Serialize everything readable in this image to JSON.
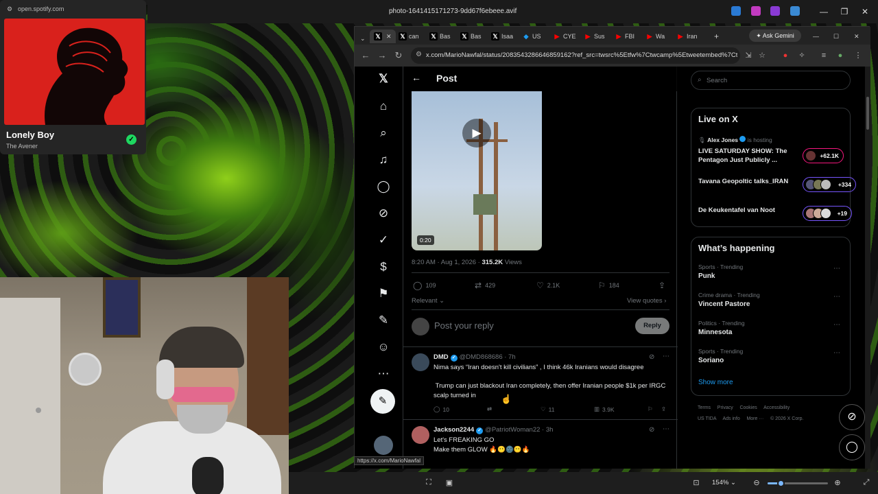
{
  "viewer": {
    "filename": "photo-1641415171273-9dd67f6ebeee.avif",
    "zoom": "154%",
    "zoom_level": 0.22
  },
  "spotify": {
    "url": "open.spotify.com",
    "song": "Lonely Boy",
    "artist": "The Avener"
  },
  "browser": {
    "tabs": [
      {
        "label": "",
        "fav": "X",
        "active": true
      },
      {
        "label": "can",
        "fav": "X"
      },
      {
        "label": "Bas",
        "fav": "X"
      },
      {
        "label": "Bas",
        "fav": "X"
      },
      {
        "label": "Isaa",
        "fav": "X"
      },
      {
        "label": "US",
        "fav": "◆"
      },
      {
        "label": "CYE",
        "fav": "▶"
      },
      {
        "label": "Sus",
        "fav": "▶"
      },
      {
        "label": "FBI",
        "fav": "▶"
      },
      {
        "label": "Wa",
        "fav": "▶"
      },
      {
        "label": "Iran",
        "fav": "▶"
      }
    ],
    "ask_gemini": "Ask Gemini",
    "url": "x.com/MarioNawfal/status/2083543286646859162?ref_src=twsrc%5Etfw%7Ctwcamp%5Etweetembed%7Ctw...",
    "status_url": "https://x.com/MarioNawfal"
  },
  "post": {
    "header_title": "Post",
    "video_duration": "0:20",
    "time": "8:20 AM · Aug 1, 2026 · ",
    "views_count": "315.2K",
    "views_label": " Views",
    "replies": "109",
    "reposts": "429",
    "likes": "2.1K",
    "bookmarks": "184",
    "relevant": "Relevant",
    "view_quotes": "View quotes",
    "reply_placeholder": "Post your reply",
    "reply_button": "Reply"
  },
  "replies": [
    {
      "name": "DMD",
      "handle": "@DMD868686 · 7h",
      "text": "Nima says “Iran doesn't kill civilians” , I think 46k Iranians would disagree\n\n Trump can just blackout Iran completely, then offer Iranian people $1k per IRGC scalp turned in",
      "replies": "10",
      "likes": "11",
      "views": "3.9K"
    },
    {
      "name": "Jackson2244",
      "handle": "@PatriotWoman22 · 3h",
      "text": "Let's FREAKING GO\nMake them GLOW 🔥😶🌚😶🔥"
    }
  ],
  "sidebar": {
    "search_placeholder": "Search",
    "live_title": "Live on X",
    "live": [
      {
        "host": "Alex Jones",
        "hosting": "is hosting",
        "title": "LIVE SATURDAY SHOW: The Pentagon Just Publicly ...",
        "count": "+62.1K",
        "color": "#f91880"
      },
      {
        "host": "",
        "hosting": "",
        "title": "Tavana Geopoltic talks_IRAN",
        "count": "+334",
        "color": "#7856ff"
      },
      {
        "host": "",
        "hosting": "",
        "title": "De Keukentafel van Noot",
        "count": "+19",
        "color": "#7856ff"
      }
    ],
    "happening_title": "What’s happening",
    "trends": [
      {
        "category": "Sports · Trending",
        "name": "Punk"
      },
      {
        "category": "Crime drama · Trending",
        "name": "Vincent Pastore"
      },
      {
        "category": "Politics · Trending",
        "name": "Minnesota"
      },
      {
        "category": "Sports · Trending",
        "name": "Soriano"
      }
    ],
    "show_more": "Show more",
    "footer_line1": "Terms     Privacy     Cookies     Accessibility",
    "footer_line2": "US TIDA     Ads info     More ···     © 2026 X Corp."
  },
  "colors": {
    "accent": "#1d9bf0",
    "spotify_green": "#1ed760",
    "spotify_art": "#d9211c"
  }
}
